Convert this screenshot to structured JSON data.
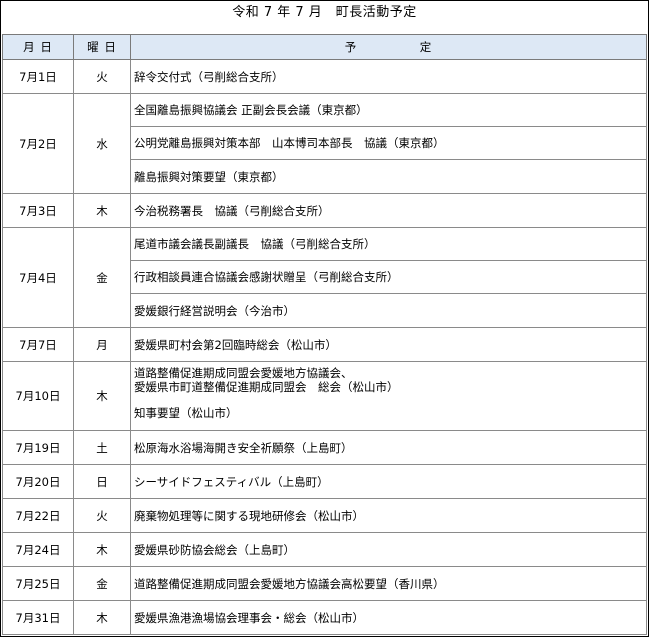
{
  "title": "令和 7 年 7 月　町長活動予定",
  "headers": {
    "date": "月 日",
    "day": "曜 日",
    "plan": "予　　　　　定"
  },
  "rows": [
    {
      "date": "7月1日",
      "day": "火",
      "entries": [
        "辞令交付式（弓削総合支所）"
      ]
    },
    {
      "date": "7月2日",
      "day": "水",
      "entries": [
        "全国離島振興協議会 正副会長会議（東京都）",
        "公明党離島振興対策本部　山本博司本部長　協議（東京都）",
        "離島振興対策要望（東京都）"
      ]
    },
    {
      "date": "7月3日",
      "day": "木",
      "entries": [
        "今治税務署長　協議（弓削総合支所）"
      ]
    },
    {
      "date": "7月4日",
      "day": "金",
      "entries": [
        "尾道市議会議長副議長　協議（弓削総合支所）",
        "行政相談員連合協議会感謝状贈呈（弓削総合支所）",
        "愛媛銀行経営説明会（今治市）"
      ]
    },
    {
      "date": "7月7日",
      "day": "月",
      "entries": [
        "愛媛県町村会第2回臨時総会（松山市）"
      ]
    },
    {
      "date": "7月10日",
      "day": "木",
      "entries": [
        "道路整備促進期成同盟会愛媛地方協議会、",
        "愛媛県市町道整備促進期成同盟会　総会（松山市）",
        "知事要望（松山市）"
      ]
    },
    {
      "date": "7月19日",
      "day": "土",
      "entries": [
        "松原海水浴場海開き安全祈願祭（上島町）"
      ]
    },
    {
      "date": "7月20日",
      "day": "日",
      "entries": [
        "シーサイドフェスティバル（上島町）"
      ]
    },
    {
      "date": "7月22日",
      "day": "火",
      "entries": [
        "廃棄物処理等に関する現地研修会（松山市）"
      ]
    },
    {
      "date": "7月24日",
      "day": "木",
      "entries": [
        "愛媛県砂防協会総会（上島町）"
      ]
    },
    {
      "date": "7月25日",
      "day": "金",
      "entries": [
        "道路整備促進期成同盟会愛媛地方協議会高松要望（香川県）"
      ]
    },
    {
      "date": "7月31日",
      "day": "木",
      "entries": [
        "愛媛県漁港漁場協会理事会・総会（松山市）"
      ]
    }
  ]
}
